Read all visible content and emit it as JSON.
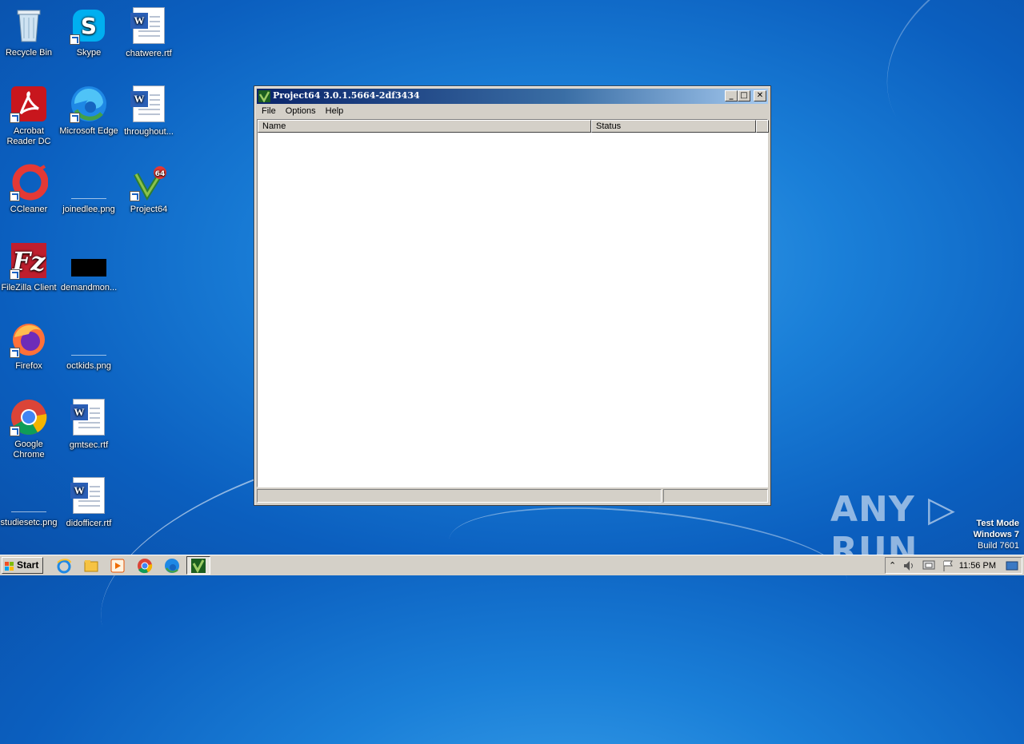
{
  "desktop": {
    "icons": [
      {
        "label": "Recycle Bin"
      },
      {
        "label": "Skype"
      },
      {
        "label": "chatwere.rtf"
      },
      {
        "label": "Acrobat Reader DC"
      },
      {
        "label": "Microsoft Edge"
      },
      {
        "label": "throughout..."
      },
      {
        "label": "CCleaner"
      },
      {
        "label": "joinedlee.png"
      },
      {
        "label": "Project64"
      },
      {
        "label": "FileZilla Client"
      },
      {
        "label": "demandmon..."
      },
      {
        "label": "Firefox"
      },
      {
        "label": "octkids.png"
      },
      {
        "label": "Google Chrome"
      },
      {
        "label": "gmtsec.rtf"
      },
      {
        "label": "studiesetc.png"
      },
      {
        "label": "didofficer.rtf"
      }
    ]
  },
  "window": {
    "title": "Project64 3.0.1.5664-2df3434",
    "minimize_glyph": "_",
    "maximize_glyph": "□",
    "close_glyph": "✕",
    "menu": [
      "File",
      "Options",
      "Help"
    ],
    "columns": [
      "Name",
      "Status"
    ]
  },
  "watermark": {
    "brand": "ANY ▷ RUN",
    "line1": "Test Mode",
    "line2": "Windows 7",
    "line3": "Build 7601"
  },
  "taskbar": {
    "start_label": "Start",
    "clock": "11:56 PM",
    "tray_arrow": "⌃"
  }
}
